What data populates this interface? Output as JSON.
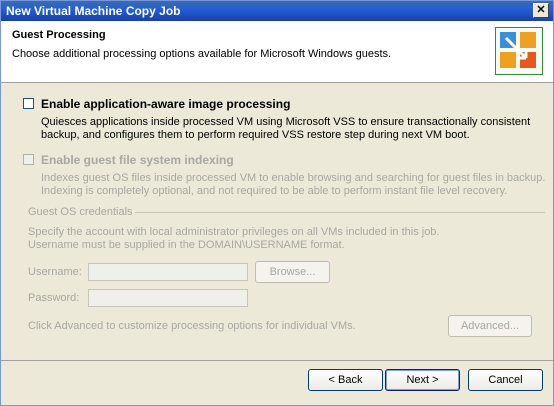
{
  "window": {
    "title": "New Virtual Machine Copy Job",
    "close_glyph": "✕"
  },
  "header": {
    "title": "Guest Processing",
    "subtitle": "Choose additional processing options available for Microsoft Windows guests.",
    "icon": "copy-job-icon"
  },
  "app_aware": {
    "label": "Enable application-aware image processing",
    "checked": false,
    "line1": "Quiesces applications inside processed VM using Microsoft VSS to ensure transactionally consistent",
    "line2": "backup, and configures them to perform required VSS restore step during next VM boot."
  },
  "indexing": {
    "label": "Enable guest file system indexing",
    "checked": false,
    "enabled": false,
    "line1": "Indexes guest OS files inside processed VM to enable browsing and searching for guest files in backup.",
    "line2": "Indexing is completely optional, and not required to be able to perform instant file level recovery."
  },
  "credentials": {
    "group_label": "Guest OS credentials",
    "line1": "Specify the account with local administrator privileges on all VMs included in this job.",
    "line2": "Username must be supplied in the DOMAIN\\USERNAME format.",
    "username_label": "Username:",
    "username_value": "",
    "browse_label": "Browse...",
    "password_label": "Password:",
    "password_value": ""
  },
  "advanced": {
    "text": "Click Advanced to customize processing options for individual VMs.",
    "button_label": "Advanced..."
  },
  "footer": {
    "back_label": "< Back",
    "next_label": "Next >",
    "cancel_label": "Cancel"
  }
}
